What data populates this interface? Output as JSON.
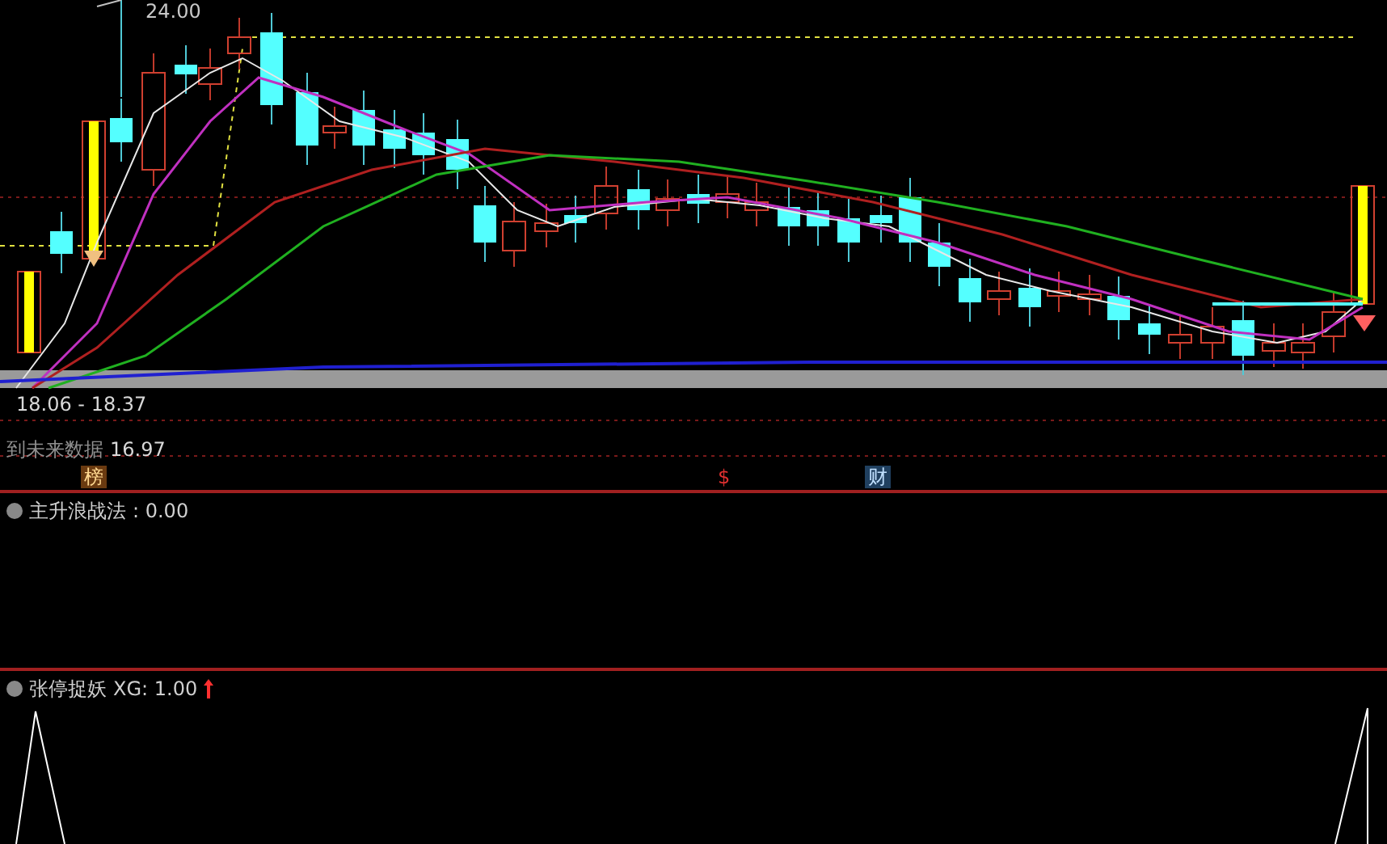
{
  "main_chart": {
    "high_label": "24.00",
    "range_label": "18.06 - 18.37",
    "overlay_text": "到未来数据",
    "low_label": "16.97",
    "markers": [
      {
        "text": "榜",
        "kind": "badge"
      },
      {
        "text": "$",
        "kind": "plain"
      },
      {
        "text": "财",
        "kind": "tag"
      }
    ]
  },
  "panels": [
    {
      "title": "主升浪战法",
      "value": ": 0.00",
      "arrow": false
    },
    {
      "title": "张停捉妖",
      "value": "XG: 1.00",
      "arrow": true
    }
  ]
}
